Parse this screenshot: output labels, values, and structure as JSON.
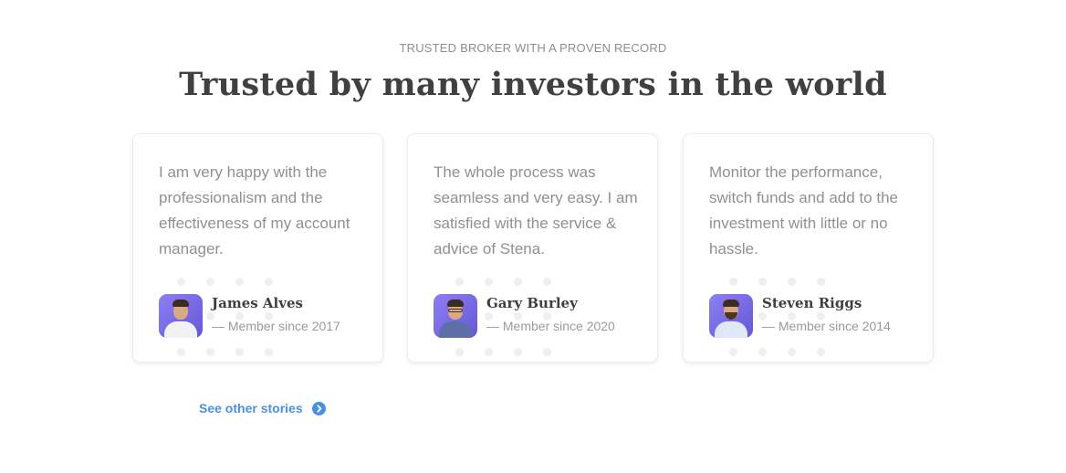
{
  "section": {
    "eyebrow": "TRUSTED BROKER WITH A PROVEN RECORD",
    "headline_highlight": "Trusted",
    "headline_rest": " by many investors in the world"
  },
  "testimonials": [
    {
      "quote": "I am very happy with the professionalism and the effectiveness of my account manager.",
      "name": "James Alves",
      "since": "— Member since 2017"
    },
    {
      "quote": "The whole process was seamless and very easy. I am satisfied with the service & advice of Stena.",
      "name": "Gary Burley",
      "since": "— Member since 2020"
    },
    {
      "quote": "Monitor the performance, switch funds and add to the investment with little or no hassle.",
      "name": "Steven Riggs",
      "since": "— Member since 2014"
    }
  ],
  "link": {
    "label": "See other stories",
    "icon": "chevron-right-circle-icon"
  },
  "colors": {
    "accent": "#4a90e2",
    "highlight": "#fde8a3",
    "avatar_bg": "#7a6be8",
    "dots": "#efeff1"
  }
}
